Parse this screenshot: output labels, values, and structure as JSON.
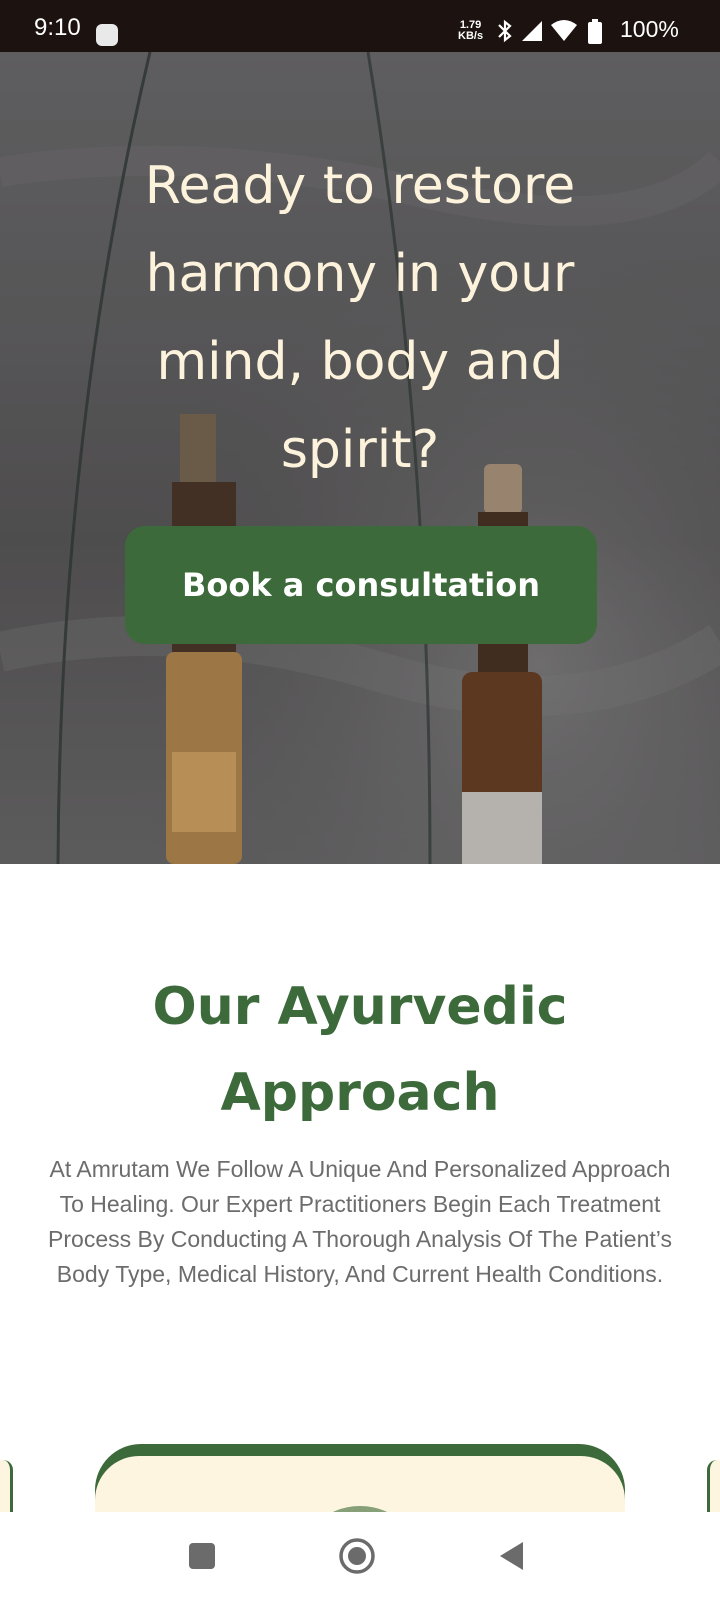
{
  "status_bar": {
    "time": "9:10",
    "net_speed_value": "1.79",
    "net_speed_unit": "KB/s",
    "battery": "100%",
    "icons": [
      "notification-icon",
      "bluetooth-icon",
      "signal-icon",
      "wifi-icon",
      "battery-icon"
    ]
  },
  "hero": {
    "title": "Ready to restore harmony in your mind, body and spirit?",
    "cta_label": "Book a consultation"
  },
  "approach": {
    "title": "Our Ayurvedic Approach",
    "description": "At Amrutam We Follow A Unique And Personalized Approach To Healing. Our Expert Practitioners Begin Each Treatment Process By Conducting A Thorough Analysis Of The Patient’s Body Type, Medical History, And Current Health Conditions."
  },
  "colors": {
    "brand_green": "#3c6a3a",
    "cream": "#fdf3dc",
    "status_bar_bg": "#1c1210"
  },
  "nav_bar": {
    "buttons": [
      "recents-button",
      "home-button",
      "back-button"
    ]
  }
}
